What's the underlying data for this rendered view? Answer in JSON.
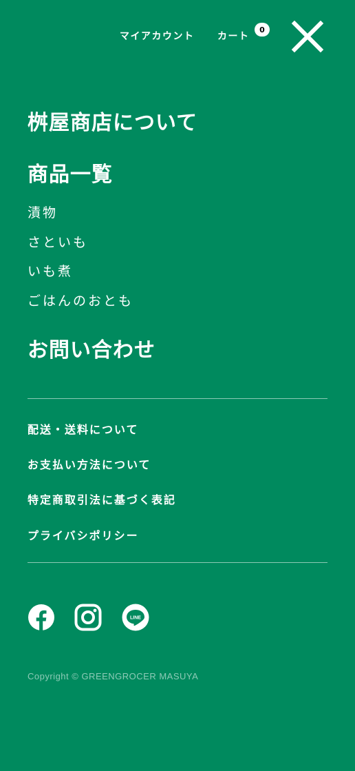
{
  "header": {
    "my_account": "マイアカウント",
    "cart": "カート",
    "cart_count": "0"
  },
  "menu": {
    "about": "桝屋商店について",
    "products": "商品一覧",
    "product_items": [
      "漬物",
      "さといも",
      "いも煮",
      "ごはんのおとも"
    ],
    "contact": "お問い合わせ"
  },
  "footer_links": [
    "配送・送料について",
    "お支払い方法について",
    "特定商取引法に基づく表記",
    "プライバシポリシー"
  ],
  "social": {
    "icons": [
      "facebook-icon",
      "instagram-icon",
      "line-icon"
    ],
    "line_text": "LINE"
  },
  "copyright": "Copyright © GREENGROCER MASUYA",
  "colors": {
    "background": "#008a5e",
    "text": "#ffffff"
  }
}
